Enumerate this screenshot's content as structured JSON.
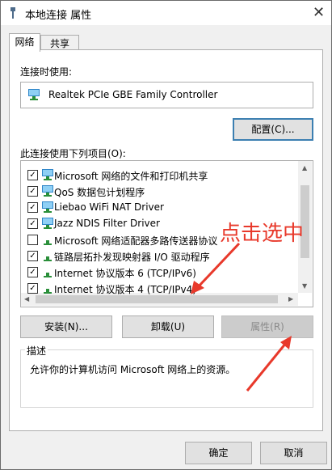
{
  "window": {
    "title": "本地连接 属性",
    "close": "✕"
  },
  "tabs": [
    {
      "label": "网络"
    },
    {
      "label": "共享"
    }
  ],
  "connect_using": {
    "label": "连接时使用:",
    "adapter": "Realtek PCIe GBE Family Controller",
    "configure_button": "配置(C)..."
  },
  "items_section": {
    "label": "此连接使用下列项目(O):",
    "items": [
      {
        "label": "Microsoft 网络的文件和打印机共享",
        "checked": true,
        "icon": "network-icon"
      },
      {
        "label": "QoS 数据包计划程序",
        "checked": true,
        "icon": "network-icon"
      },
      {
        "label": "Liebao WiFi NAT Driver",
        "checked": true,
        "icon": "network-icon"
      },
      {
        "label": "Jazz NDIS Filter Driver",
        "checked": true,
        "icon": "network-icon"
      },
      {
        "label": "Microsoft 网络适配器多路传送器协议",
        "checked": false,
        "icon": "protocol-icon"
      },
      {
        "label": "链路层拓扑发现映射器 I/O 驱动程序",
        "checked": true,
        "icon": "protocol-icon"
      },
      {
        "label": "Internet 协议版本 6 (TCP/IPv6)",
        "checked": true,
        "icon": "protocol-icon"
      },
      {
        "label": "Internet 协议版本 4 (TCP/IPv4)",
        "checked": true,
        "icon": "protocol-icon"
      }
    ]
  },
  "buttons": {
    "install": "安装(N)...",
    "uninstall": "卸载(U)",
    "properties": "属性(R)"
  },
  "description": {
    "label": "描述",
    "text": "允许你的计算机访问 Microsoft 网络上的资源。"
  },
  "annotation": {
    "text": "点击选中",
    "color": "#e8392b"
  },
  "footer": {
    "ok": "确定",
    "cancel": "取消"
  },
  "check_mark": "✓"
}
